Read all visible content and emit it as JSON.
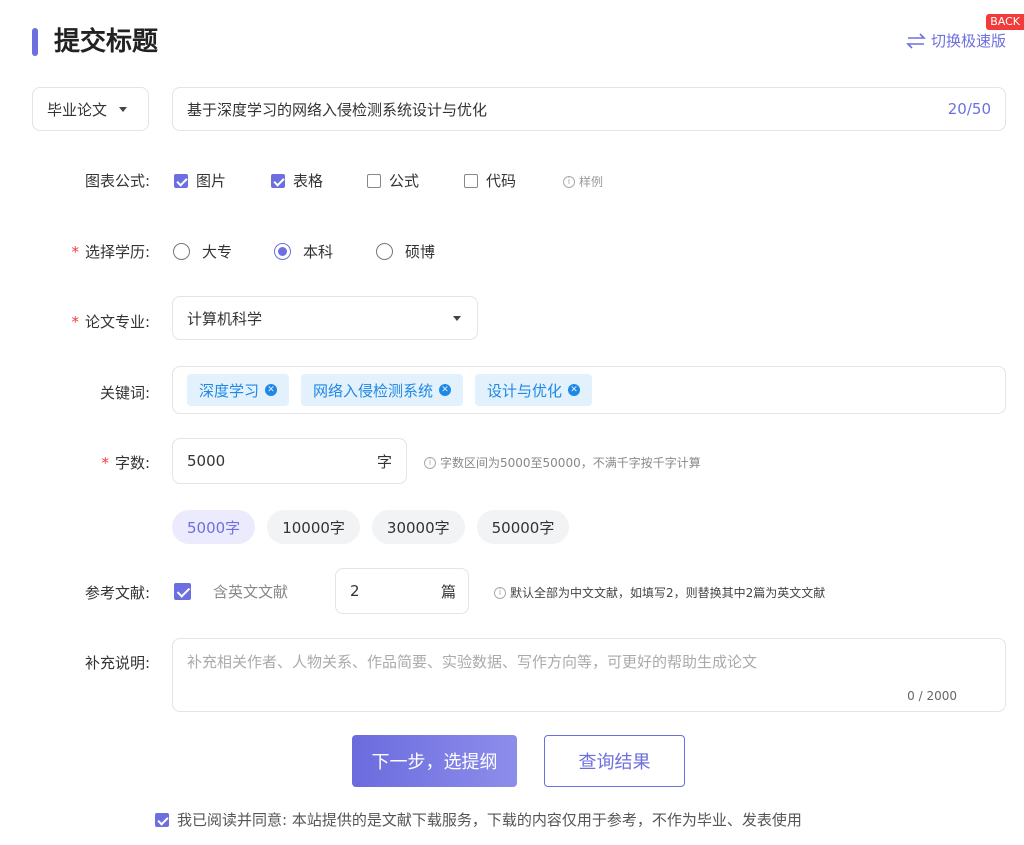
{
  "header": {
    "title": "提交标题",
    "switch_label": "切换极速版",
    "back_badge": "BACK"
  },
  "paper_type": {
    "selected": "毕业论文"
  },
  "title_input": {
    "value": "基于深度学习的网络入侵检测系统设计与优化",
    "counter": "20/50"
  },
  "charts": {
    "label": "图表公式:",
    "options": [
      {
        "label": "图片",
        "checked": true
      },
      {
        "label": "表格",
        "checked": true
      },
      {
        "label": "公式",
        "checked": false
      },
      {
        "label": "代码",
        "checked": false
      }
    ],
    "sample_hint": "样例"
  },
  "education": {
    "label": "选择学历:",
    "options": [
      {
        "label": "大专",
        "selected": false
      },
      {
        "label": "本科",
        "selected": true
      },
      {
        "label": "硕博",
        "selected": false
      }
    ]
  },
  "major": {
    "label": "论文专业:",
    "selected": "计算机科学"
  },
  "keywords": {
    "label": "关键词:",
    "tags": [
      "深度学习",
      "网络入侵检测系统",
      "设计与优化"
    ]
  },
  "word_count": {
    "label": "字数:",
    "value": "5000",
    "unit": "字",
    "hint": "字数区间为5000至50000，不满千字按千字计算",
    "presets": [
      "5000字",
      "10000字",
      "30000字",
      "50000字"
    ],
    "selected_preset": 0
  },
  "references": {
    "label": "参考文献:",
    "include_english_label": "含英文文献",
    "include_english": true,
    "count": "2",
    "unit": "篇",
    "hint": "默认全部为中文文献，如填写2，则替换其中2篇为英文文献"
  },
  "notes": {
    "label": "补充说明:",
    "placeholder": "补充相关作者、人物关系、作品简要、实验数据、写作方向等，可更好的帮助生成论文",
    "counter": "0 / 2000"
  },
  "actions": {
    "next_label": "下一步，选提纲",
    "query_label": "查询结果"
  },
  "agreement": {
    "text": "我已阅读并同意: 本站提供的是文献下载服务，下载的内容仅用于参考，不作为毕业、发表使用",
    "checked": true
  },
  "colors": {
    "accent": "#6d6fe0",
    "required": "#f23b3b",
    "tag_text": "#1e88e5",
    "tag_bg": "#e3f1fd"
  }
}
